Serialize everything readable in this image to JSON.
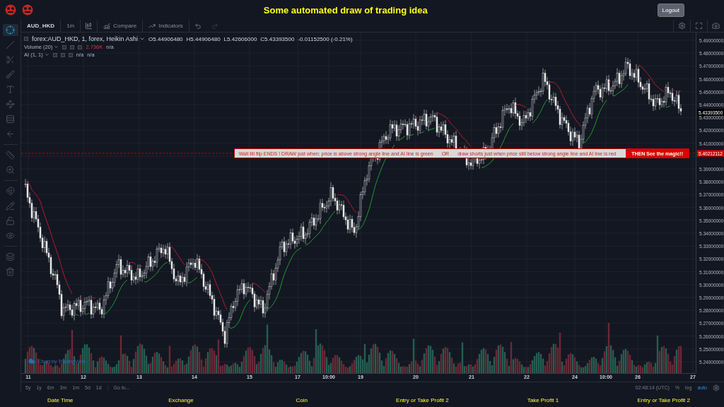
{
  "header": {
    "title": "Some automated draw of trading idea",
    "logout": "Logout"
  },
  "toolbar": {
    "symbol": "AUD_HKD",
    "interval": "1m",
    "compare": "Compare",
    "indicators": "Indicators"
  },
  "tools": [
    {
      "kind": "crosshair",
      "selected": true
    },
    {
      "kind": "line",
      "selected": false
    },
    {
      "kind": "fork",
      "selected": false
    },
    {
      "kind": "brush",
      "selected": false
    },
    {
      "kind": "text",
      "selected": false
    },
    {
      "kind": "pattern",
      "selected": false
    },
    {
      "kind": "rows",
      "selected": false
    },
    {
      "kind": "arrow",
      "selected": false
    },
    {
      "kind": "ruler",
      "selected": false
    },
    {
      "kind": "zoom",
      "selected": false
    },
    {
      "kind": "magnet",
      "selected": false
    },
    {
      "kind": "pencil",
      "selected": false
    },
    {
      "kind": "lock",
      "selected": false
    },
    {
      "kind": "eye",
      "selected": false
    },
    {
      "kind": "layers",
      "selected": false
    },
    {
      "kind": "trash",
      "selected": false
    }
  ],
  "legend": {
    "title": "forex:AUD_HKD, 1, forex, Heikin Ashi",
    "ohlc": [
      "O5.44906480",
      "H5.44906480",
      "L5.42606000",
      "C5.43393500"
    ],
    "change": "-0.01152500 (-0.21%)",
    "studies": [
      {
        "name": "Volume (20)",
        "values": [
          {
            "text": "2.736K",
            "kind": "alert"
          },
          {
            "text": "n/a",
            "kind": "plain"
          }
        ]
      },
      {
        "name": "AI (1, 1)",
        "values": [
          {
            "text": "n/a",
            "kind": "plain"
          },
          {
            "text": "n/a",
            "kind": "plain"
          }
        ]
      }
    ]
  },
  "banner": {
    "parts": [
      "Wait till flip ENDS  !  DRAW just when:  price is above strong angle line and AI line is green",
      "OR",
      "draw shorts just when price still below strong angle line and AI line is red"
    ],
    "end": "THEN See the magic!!"
  },
  "price_axis": {
    "labels": [
      "5.49000000",
      "5.48000000",
      "5.47000000",
      "5.46000000",
      "5.45000000",
      "5.44000000",
      "5.43000000",
      "5.42000000",
      "5.41000000",
      "5.39000000",
      "5.38000000",
      "5.37000000",
      "5.36000000",
      "5.35000000",
      "5.34000000",
      "5.33000000",
      "5.32000000",
      "5.31000000",
      "5.30000000",
      "5.29000000",
      "5.28000000",
      "5.27000000",
      "5.26000000",
      "5.25000000",
      "5.24000000"
    ],
    "last_price": "5.43393500",
    "line_price": "5.40212112"
  },
  "time_axis": [
    "11",
    "12",
    "13",
    "14",
    "15",
    "17",
    "10:00",
    "19",
    "20",
    "21",
    "22",
    "24",
    "10:00",
    "26",
    "27"
  ],
  "attribution": "Chart by TradingView",
  "ranges": [
    "5y",
    "1y",
    "6m",
    "3m",
    "1m",
    "5d",
    "1d"
  ],
  "goto": "Go to...",
  "clock": "02:48:14 (UTC)",
  "scale": [
    {
      "label": "%",
      "selected": false
    },
    {
      "label": "log",
      "selected": false
    },
    {
      "label": "auto",
      "selected": true
    }
  ],
  "columns": [
    "Date Time",
    "Exchange",
    "Coin",
    "Entry or Take Profit 2",
    "Take Profit 1",
    "Entry or Take Profit 2"
  ]
}
